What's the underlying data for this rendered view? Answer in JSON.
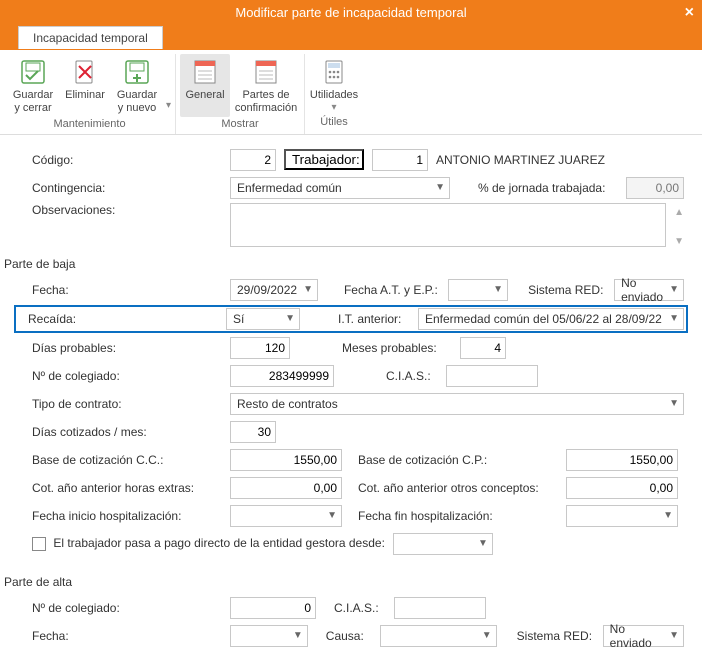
{
  "titlebar": {
    "title": "Modificar parte de incapacidad temporal"
  },
  "tab": {
    "label": "Incapacidad temporal"
  },
  "ribbon": {
    "group_mantenimiento": {
      "caption": "Mantenimiento",
      "save_close": "Guardar\ny cerrar",
      "delete": "Eliminar",
      "save_new": "Guardar\ny nuevo"
    },
    "group_mostrar": {
      "caption": "Mostrar",
      "general": "General",
      "confirm": "Partes de\nconfirmación"
    },
    "group_utiles": {
      "caption": "Útiles",
      "utilidades": "Utilidades"
    }
  },
  "main": {
    "codigo_label": "Código:",
    "codigo_value": "2",
    "trabajador_btn": "Trabajador:",
    "trabajador_code": "1",
    "trabajador_name": "ANTONIO MARTINEZ JUAREZ",
    "contingencia_label": "Contingencia:",
    "contingencia_value": "Enfermedad común",
    "jornada_label": "% de jornada trabajada:",
    "jornada_value": "0,00",
    "observaciones_label": "Observaciones:",
    "observaciones_value": ""
  },
  "baja": {
    "section": "Parte de baja",
    "fecha_label": "Fecha:",
    "fecha_value": "29/09/2022",
    "fecha_at_label": "Fecha A.T. y E.P.:",
    "fecha_at_value": "",
    "sistema_red_label": "Sistema RED:",
    "sistema_red_value": "No enviado",
    "recaida_label": "Recaída:",
    "recaida_value": "Sí",
    "it_anterior_label": "I.T. anterior:",
    "it_anterior_value": "Enfermedad común del 05/06/22 al 28/09/22",
    "dias_prob_label": "Días probables:",
    "dias_prob_value": "120",
    "meses_prob_label": "Meses probables:",
    "meses_prob_value": "4",
    "ncolegiado_label": "Nº de colegiado:",
    "ncolegiado_value": "283499999",
    "cias_label": "C.I.A.S.:",
    "cias_value": "",
    "tipo_contrato_label": "Tipo de contrato:",
    "tipo_contrato_value": "Resto de contratos",
    "dias_cot_label": "Días cotizados / mes:",
    "dias_cot_value": "30",
    "base_cc_label": "Base de cotización C.C.:",
    "base_cc_value": "1550,00",
    "base_cp_label": "Base de cotización C.P.:",
    "base_cp_value": "1550,00",
    "cot_horas_label": "Cot. año anterior horas extras:",
    "cot_horas_value": "0,00",
    "cot_otros_label": "Cot. año anterior otros conceptos:",
    "cot_otros_value": "0,00",
    "hosp_ini_label": "Fecha inicio hospitalización:",
    "hosp_ini_value": "",
    "hosp_fin_label": "Fecha fin hospitalización:",
    "hosp_fin_value": "",
    "pago_directo_label": "El trabajador pasa a pago directo de la entidad gestora desde:",
    "pago_directo_value": ""
  },
  "alta": {
    "section": "Parte de alta",
    "ncolegiado_label": "Nº de colegiado:",
    "ncolegiado_value": "0",
    "cias_label": "C.I.A.S.:",
    "cias_value": "",
    "fecha_label": "Fecha:",
    "fecha_value": "",
    "causa_label": "Causa:",
    "causa_value": "",
    "sistema_red_label": "Sistema RED:",
    "sistema_red_value": "No enviado"
  }
}
